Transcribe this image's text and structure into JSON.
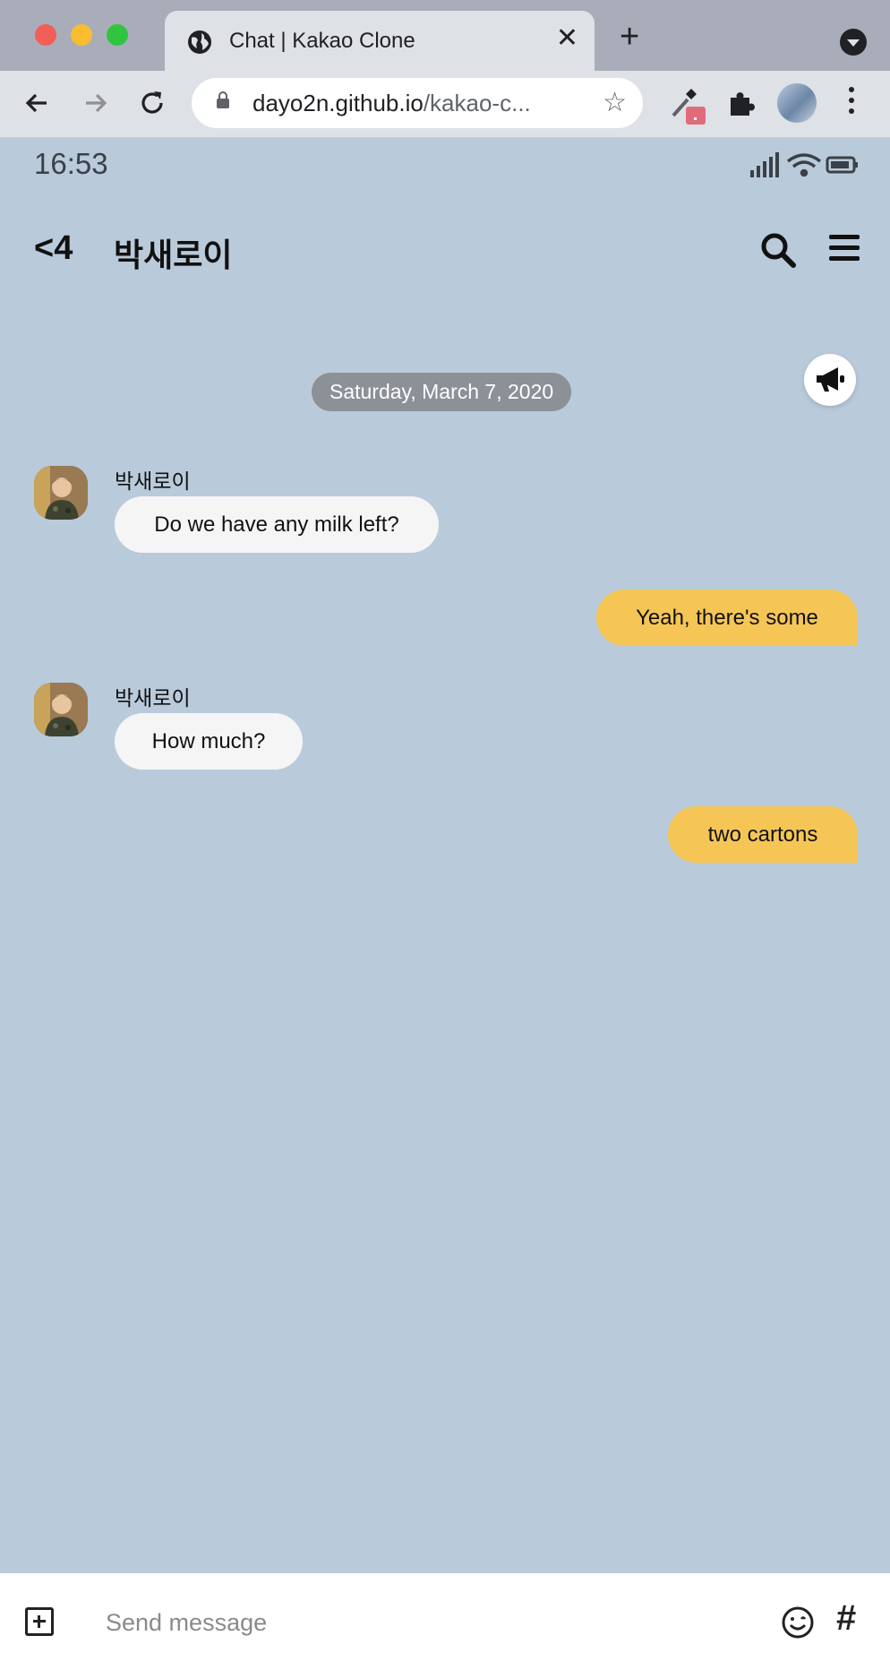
{
  "browser": {
    "tab_title": "Chat | Kakao Clone",
    "tab_close": "✕",
    "new_tab": "+",
    "url_host": "dayo2n.github.io",
    "url_path": "/kakao-c..."
  },
  "status_bar": {
    "time": "16:53"
  },
  "header": {
    "back_label": "<4",
    "title": "박새로이"
  },
  "chat": {
    "date": "Saturday, March 7, 2020",
    "messages": [
      {
        "direction": "in",
        "sender": "박새로이",
        "text": "Do we have any milk left?"
      },
      {
        "direction": "out",
        "text": "Yeah, there's some"
      },
      {
        "direction": "in",
        "sender": "박새로이",
        "text": "How much?"
      },
      {
        "direction": "out",
        "text": "two cartons"
      }
    ]
  },
  "composer": {
    "placeholder": "Send message",
    "hash": "#"
  },
  "colors": {
    "background": "#b9cadb",
    "outgoing_bubble": "#f5c656",
    "incoming_bubble": "#f5f5f5"
  }
}
